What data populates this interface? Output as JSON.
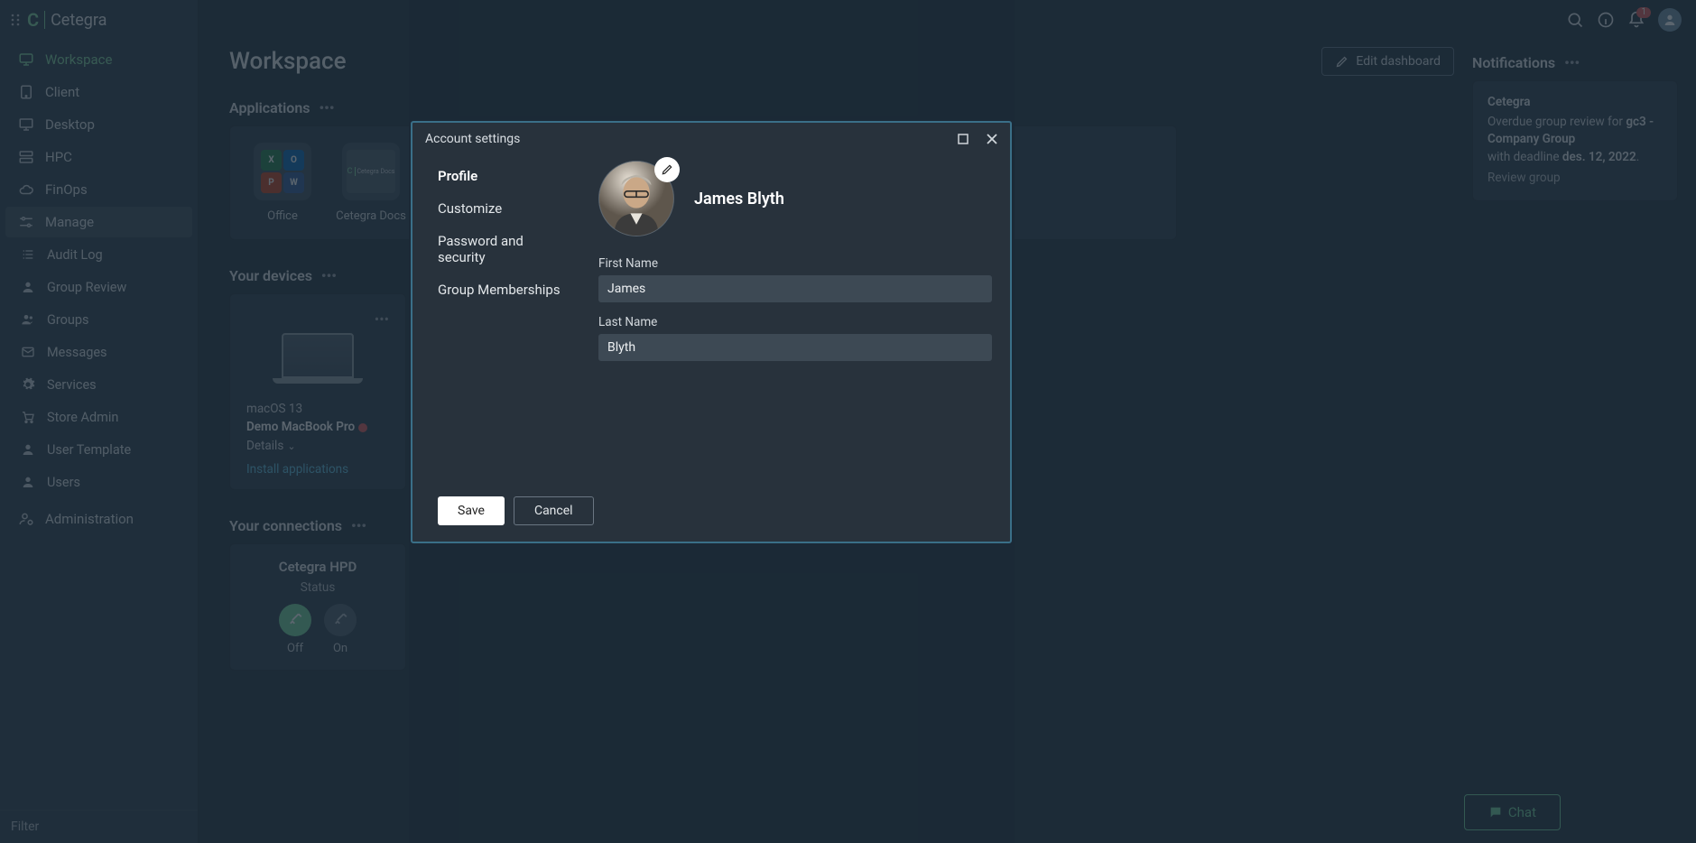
{
  "brand": "Cetegra",
  "topbar": {
    "notif_badge": "1"
  },
  "sidebar": {
    "filter": "Filter",
    "items": [
      {
        "label": "Workspace",
        "key": "workspace"
      },
      {
        "label": "Client",
        "key": "client"
      },
      {
        "label": "Desktop",
        "key": "desktop"
      },
      {
        "label": "HPC",
        "key": "hpc"
      },
      {
        "label": "FinOps",
        "key": "finops"
      },
      {
        "label": "Manage",
        "key": "manage"
      }
    ],
    "sub": [
      {
        "label": "Audit Log"
      },
      {
        "label": "Group Review"
      },
      {
        "label": "Groups"
      },
      {
        "label": "Messages"
      },
      {
        "label": "Services"
      },
      {
        "label": "Store Admin"
      },
      {
        "label": "User Template"
      },
      {
        "label": "Users"
      }
    ],
    "admin": "Administration"
  },
  "page": {
    "title": "Workspace",
    "edit_btn": "Edit dashboard",
    "apps_title": "Applications",
    "apps": [
      {
        "label": "Office"
      },
      {
        "label": "Cetegra Docs"
      }
    ],
    "devices_title": "Your devices",
    "device": {
      "os": "macOS 13",
      "name": "Demo MacBook Pro",
      "details": "Details",
      "install": "Install applications"
    },
    "conn_title": "Your connections",
    "conn": {
      "name": "Cetegra HPD",
      "status": "Status",
      "off": "Off",
      "on": "On"
    }
  },
  "notifications": {
    "title": "Notifications",
    "card": {
      "app": "Cetegra",
      "line1a": "Overdue group review for ",
      "line1b": "gc3 - Company Group",
      "line2a": "with deadline ",
      "line2b": "des. 12, 2022",
      "dot": ".",
      "link": "Review group"
    }
  },
  "chat": "Chat",
  "modal": {
    "title": "Account settings",
    "nav": [
      "Profile",
      "Customize",
      "Password and security",
      "Group Memberships"
    ],
    "display_name": "James Blyth",
    "first_label": "First Name",
    "first_value": "James",
    "last_label": "Last Name",
    "last_value": "Blyth",
    "save": "Save",
    "cancel": "Cancel"
  }
}
